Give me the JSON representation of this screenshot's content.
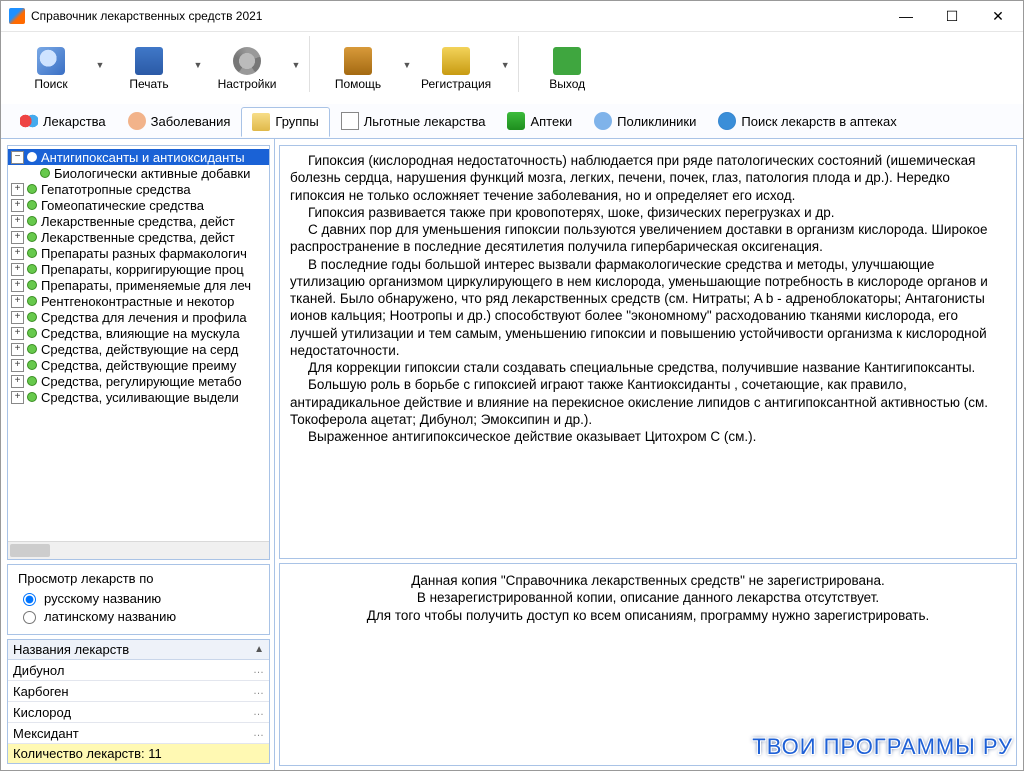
{
  "window": {
    "title": "Справочник лекарственных средств 2021"
  },
  "toolbar": {
    "search": "Поиск",
    "print": "Печать",
    "settings": "Настройки",
    "help": "Помощь",
    "register": "Регистрация",
    "exit": "Выход"
  },
  "tabs": {
    "meds": "Лекарства",
    "diseases": "Заболевания",
    "groups": "Группы",
    "benefit": "Льготные лекарства",
    "pharmacies": "Аптеки",
    "clinics": "Поликлиники",
    "searchpharm": "Поиск лекарств в аптеках"
  },
  "tree": [
    {
      "expand": "-",
      "label": "Антигипоксанты и антиоксиданты",
      "sel": true,
      "indent": 0
    },
    {
      "expand": "",
      "label": "Биологически активные добавки",
      "indent": 1
    },
    {
      "expand": "+",
      "label": "Гепатотропные средства",
      "indent": 0
    },
    {
      "expand": "+",
      "label": "Гомеопатические средства",
      "indent": 0
    },
    {
      "expand": "+",
      "label": "Лекарственные средства, дейст",
      "indent": 0
    },
    {
      "expand": "+",
      "label": "Лекарственные средства, дейст",
      "indent": 0
    },
    {
      "expand": "+",
      "label": "Препараты разных фармакологич",
      "indent": 0
    },
    {
      "expand": "+",
      "label": "Препараты, корригирующие проц",
      "indent": 0
    },
    {
      "expand": "+",
      "label": "Препараты, применяемые для леч",
      "indent": 0
    },
    {
      "expand": "+",
      "label": "Рентгеноконтрастные и некотор",
      "indent": 0
    },
    {
      "expand": "+",
      "label": "Средства для лечения и профила",
      "indent": 0
    },
    {
      "expand": "+",
      "label": "Средства, влияющие на мускула",
      "indent": 0
    },
    {
      "expand": "+",
      "label": "Средства, действующие на серд",
      "indent": 0
    },
    {
      "expand": "+",
      "label": "Средства, действующие преиму",
      "indent": 0
    },
    {
      "expand": "+",
      "label": "Средства, регулирующие метабо",
      "indent": 0
    },
    {
      "expand": "+",
      "label": "Средства, усиливающие выдели",
      "indent": 0
    }
  ],
  "viewby": {
    "group": "Просмотр лекарств по",
    "ru": "русскому названию",
    "lat": "латинскому названию"
  },
  "medlist": {
    "header": "Названия лекарств",
    "items": [
      "Дибунол",
      "Карбоген",
      "Кислород",
      "Мексидант"
    ],
    "count": "Количество лекарств: 11"
  },
  "article": {
    "p1": "Гипоксия (кислородная недостаточность) наблюдается при ряде патологических состояний (ишемическая болезнь сердца, нарушения функций мозга, легких, печени, почек, глаз, патология плода и др.). Нередко гипоксия не только осложняет течение заболевания, но и определяет его исход.",
    "p2": "Гипоксия развивается также при кровопотерях, шоке, физических перегрузках и др.",
    "p3": "С давних пор для уменьшения гипоксии пользуются увеличением доставки в организм кислорода. Широкое распространение в последние десятилетия получила гипербарическая оксигенация.",
    "p4": "В последние годы большой интерес вызвали фармакологические средства и методы, улучшающие утилизацию организмом циркулирующего в нем кислорода, уменьшающие потребность в кислороде органов и тканей. Было обнаружено, что ряд лекарственных средств (см. Нитраты; A b - адреноблокаторы; Антагонисты ионов кальция; Ноотропы и др.) способствуют более \"экономному\" расходованию тканями кислорода, его лучшей утилизации и тем самым, уменьшению гипоксии и повышению устойчивости организма к кислородной недостаточности.",
    "p5": "Для коррекции гипоксии стали создавать специальные средства, получившие название Кантигипоксанты.",
    "p6": "Большую роль в борьбе с гипоксией играют также Кантиоксиданты , сочетающие, как правило, антирадикальное действие и влияние на перекисное окисление липидов с антигипоксантной активностью (см. Токоферола ацетат; Дибунол; Эмоксипин и др.).",
    "p7": "Выраженное антигипоксическое действие оказывает Цитохром С (см.)."
  },
  "notice": {
    "l1": "Данная копия \"Справочника лекарственных средств\" не зарегистрирована.",
    "l2": "В незарегистрированной копии, описание данного лекарства отсутствует.",
    "l3": "Для того чтобы получить доступ ко всем описаниям, программу нужно зарегистрировать."
  },
  "watermark": "ТВОИ ПРОГРАММЫ РУ"
}
